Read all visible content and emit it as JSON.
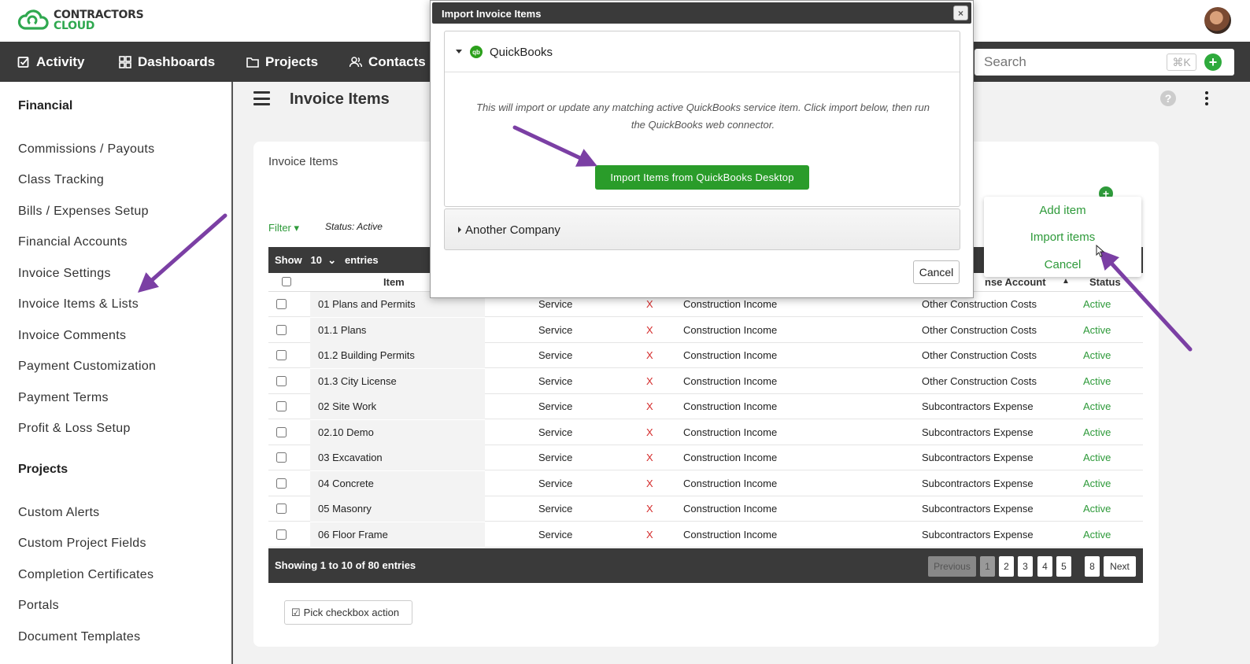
{
  "brand": {
    "line1": "CONTRACTORS",
    "line2": "CLOUD"
  },
  "nav": {
    "items": [
      "Activity",
      "Dashboards",
      "Projects",
      "Contacts"
    ],
    "search_placeholder": "Search",
    "search_shortcut": "⌘K"
  },
  "sidebar": {
    "sections": [
      {
        "heading": "Financial",
        "items": [
          "Commissions / Payouts",
          "Class Tracking",
          "Bills / Expenses Setup",
          "Financial Accounts",
          "Invoice Settings",
          "Invoice Items & Lists",
          "Invoice Comments",
          "Payment Customization",
          "Payment Terms",
          "Profit & Loss Setup"
        ]
      },
      {
        "heading": "Projects",
        "items": [
          "Custom Alerts",
          "Custom Project Fields",
          "Completion Certificates",
          "Portals",
          "Document Templates"
        ]
      }
    ]
  },
  "page": {
    "title": "Invoice Items"
  },
  "card": {
    "title": "Invoice Items",
    "filter_label": "Filter",
    "filter_status": "Status: Active",
    "show_label": "Show",
    "show_value": "10",
    "entries_label": "entries",
    "headers": {
      "item": "Item",
      "account": "nse Account",
      "status": "Status"
    },
    "rows": [
      {
        "item": "01 Plans and Permits",
        "type": "Service",
        "x": "X",
        "income": "Construction Income",
        "expense": "Other Construction Costs",
        "status": "Active"
      },
      {
        "item": "01.1 Plans",
        "type": "Service",
        "x": "X",
        "income": "Construction Income",
        "expense": "Other Construction Costs",
        "status": "Active"
      },
      {
        "item": "01.2 Building Permits",
        "type": "Service",
        "x": "X",
        "income": "Construction Income",
        "expense": "Other Construction Costs",
        "status": "Active"
      },
      {
        "item": "01.3 City License",
        "type": "Service",
        "x": "X",
        "income": "Construction Income",
        "expense": "Other Construction Costs",
        "status": "Active"
      },
      {
        "item": "02 Site Work",
        "type": "Service",
        "x": "X",
        "income": "Construction Income",
        "expense": "Subcontractors Expense",
        "status": "Active"
      },
      {
        "item": "02.10 Demo",
        "type": "Service",
        "x": "X",
        "income": "Construction Income",
        "expense": "Subcontractors Expense",
        "status": "Active"
      },
      {
        "item": "03 Excavation",
        "type": "Service",
        "x": "X",
        "income": "Construction Income",
        "expense": "Subcontractors Expense",
        "status": "Active"
      },
      {
        "item": "04 Concrete",
        "type": "Service",
        "x": "X",
        "income": "Construction Income",
        "expense": "Subcontractors Expense",
        "status": "Active"
      },
      {
        "item": "05 Masonry",
        "type": "Service",
        "x": "X",
        "income": "Construction Income",
        "expense": "Subcontractors Expense",
        "status": "Active"
      },
      {
        "item": "06 Floor Frame",
        "type": "Service",
        "x": "X",
        "income": "Construction Income",
        "expense": "Subcontractors Expense",
        "status": "Active"
      }
    ],
    "showing": "Showing 1 to 10 of 80 entries",
    "pagination": [
      "Previous",
      "1",
      "2",
      "3",
      "4",
      "5",
      "8",
      "Next"
    ],
    "pick_action": "Pick checkbox action"
  },
  "dropdown": {
    "items": [
      "Add item",
      "Import items",
      "Cancel"
    ]
  },
  "modal": {
    "title": "Import Invoice Items",
    "close": "×",
    "section1_title": "QuickBooks",
    "qb_badge": "qb",
    "description": "This will import or update any matching active QuickBooks service item. Click import below, then run the QuickBooks web connector.",
    "import_button": "Import Items from QuickBooks Desktop",
    "section2_title": "Another Company",
    "cancel": "Cancel"
  },
  "colors": {
    "accent_green": "#2e9a3a",
    "nav_bg": "#3a3a3a",
    "arrow_purple": "#7b3fa4",
    "error_red": "#d42b2b"
  }
}
